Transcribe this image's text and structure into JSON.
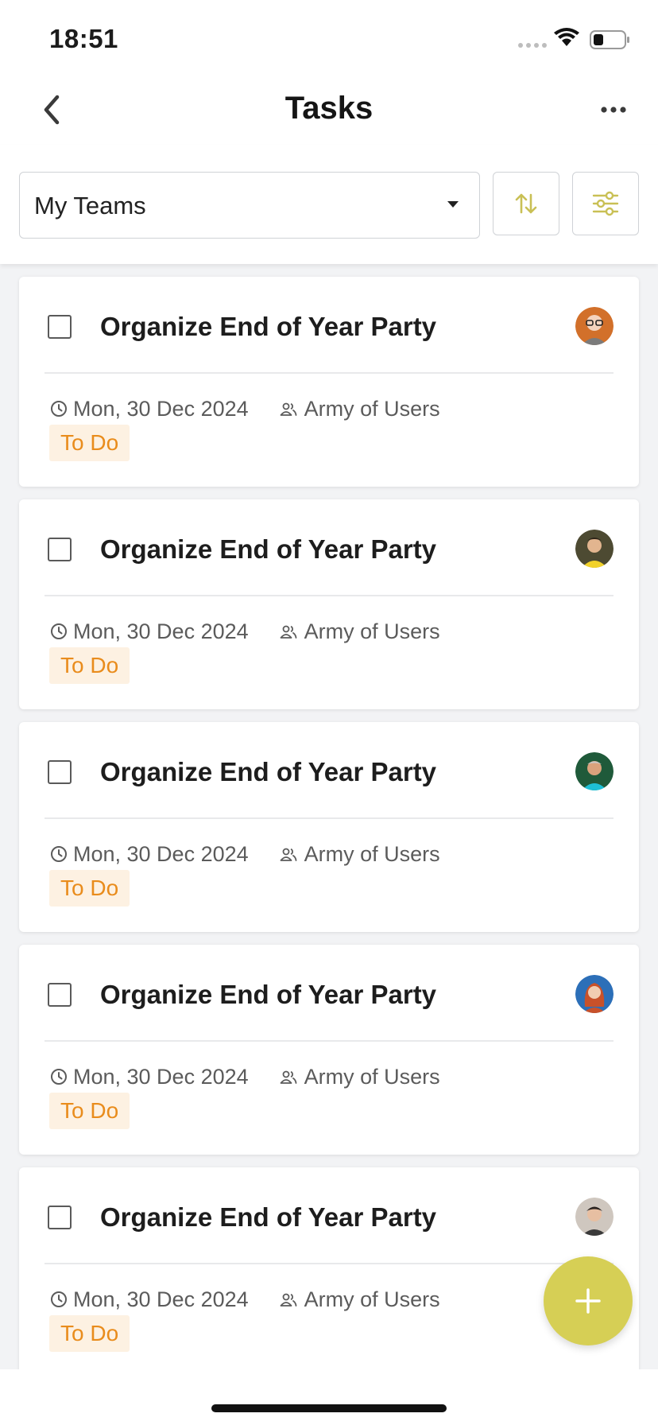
{
  "status_bar": {
    "time": "18:51"
  },
  "nav": {
    "title": "Tasks"
  },
  "filter": {
    "team_select_label": "My Teams"
  },
  "colors": {
    "accent": "#d6cf55",
    "status_todo_bg": "#fdf1e2",
    "status_todo_text": "#e98c1c"
  },
  "icons": {
    "back": "chevron-left-icon",
    "more": "more-horizontal-icon",
    "sort": "sort-arrows-icon",
    "filter": "sliders-icon",
    "date": "clock-icon",
    "team": "people-icon",
    "fab": "plus-icon"
  },
  "tasks": [
    {
      "title": "Organize End of Year Party",
      "date": "Mon, 30 Dec 2024",
      "team": "Army of Users",
      "status": "To Do"
    },
    {
      "title": "Organize End of Year Party",
      "date": "Mon, 30 Dec 2024",
      "team": "Army of Users",
      "status": "To Do"
    },
    {
      "title": "Organize End of Year Party",
      "date": "Mon, 30 Dec 2024",
      "team": "Army of Users",
      "status": "To Do"
    },
    {
      "title": "Organize End of Year Party",
      "date": "Mon, 30 Dec 2024",
      "team": "Army of Users",
      "status": "To Do"
    },
    {
      "title": "Organize End of Year Party",
      "date": "Mon, 30 Dec 2024",
      "team": "Army of Users",
      "status": "To Do"
    }
  ]
}
